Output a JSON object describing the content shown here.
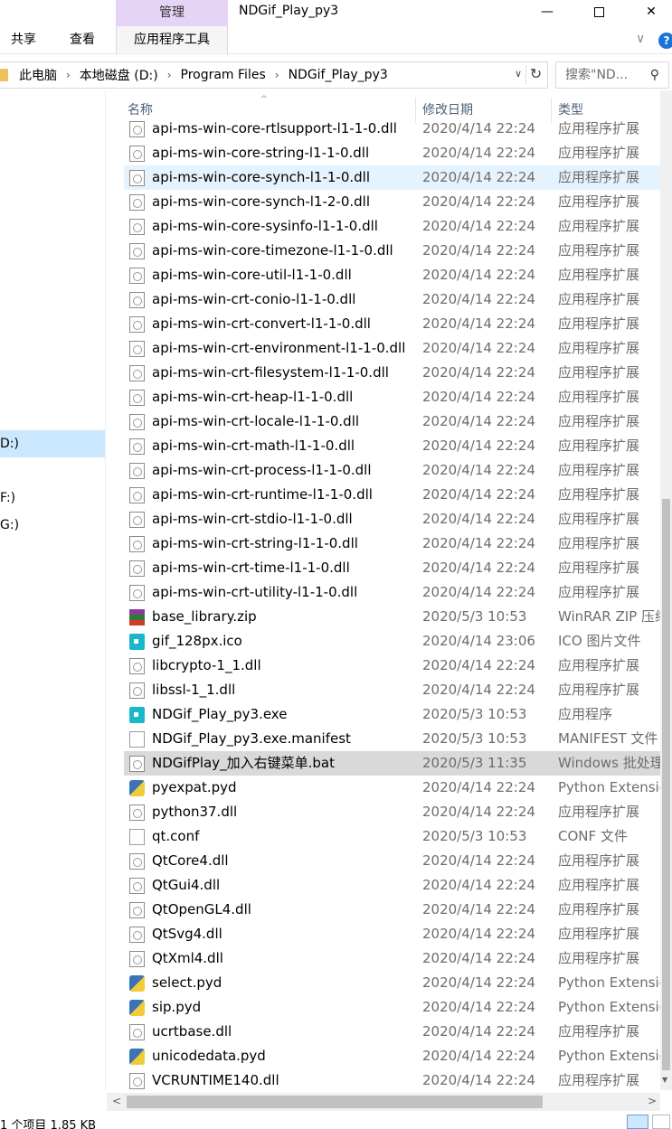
{
  "window": {
    "title": "NDGif_Play_py3",
    "context_tab_group": "管理",
    "min_glyph": "—",
    "close_glyph": "✕"
  },
  "ribbon": {
    "tabs": [
      "共享",
      "查看",
      "应用程序工具"
    ],
    "collapse_glyph": "∨",
    "help_glyph": "?"
  },
  "address": {
    "crumbs": [
      "此电脑",
      "本地磁盘 (D:)",
      "Program Files",
      "NDGif_Play_py3"
    ],
    "separator": "›",
    "dropdown_glyph": "∨",
    "refresh_glyph": "↻"
  },
  "search": {
    "placeholder": "搜索\"ND...",
    "icon_glyph": "⚲"
  },
  "nav": {
    "items": [
      "D:)",
      "F:)",
      "G:)"
    ]
  },
  "columns": {
    "name": "名称",
    "date": "修改日期",
    "type": "类型",
    "sort_glyph": "^"
  },
  "files": [
    {
      "name": "api-ms-win-core-rtlsupport-l1-1-0.dll",
      "date": "2020/4/14 22:24",
      "type": "应用程序扩展",
      "icon": "dll"
    },
    {
      "name": "api-ms-win-core-string-l1-1-0.dll",
      "date": "2020/4/14 22:24",
      "type": "应用程序扩展",
      "icon": "dll"
    },
    {
      "name": "api-ms-win-core-synch-l1-1-0.dll",
      "date": "2020/4/14 22:24",
      "type": "应用程序扩展",
      "icon": "dll",
      "state": "hover"
    },
    {
      "name": "api-ms-win-core-synch-l1-2-0.dll",
      "date": "2020/4/14 22:24",
      "type": "应用程序扩展",
      "icon": "dll"
    },
    {
      "name": "api-ms-win-core-sysinfo-l1-1-0.dll",
      "date": "2020/4/14 22:24",
      "type": "应用程序扩展",
      "icon": "dll"
    },
    {
      "name": "api-ms-win-core-timezone-l1-1-0.dll",
      "date": "2020/4/14 22:24",
      "type": "应用程序扩展",
      "icon": "dll"
    },
    {
      "name": "api-ms-win-core-util-l1-1-0.dll",
      "date": "2020/4/14 22:24",
      "type": "应用程序扩展",
      "icon": "dll"
    },
    {
      "name": "api-ms-win-crt-conio-l1-1-0.dll",
      "date": "2020/4/14 22:24",
      "type": "应用程序扩展",
      "icon": "dll"
    },
    {
      "name": "api-ms-win-crt-convert-l1-1-0.dll",
      "date": "2020/4/14 22:24",
      "type": "应用程序扩展",
      "icon": "dll"
    },
    {
      "name": "api-ms-win-crt-environment-l1-1-0.dll",
      "date": "2020/4/14 22:24",
      "type": "应用程序扩展",
      "icon": "dll"
    },
    {
      "name": "api-ms-win-crt-filesystem-l1-1-0.dll",
      "date": "2020/4/14 22:24",
      "type": "应用程序扩展",
      "icon": "dll"
    },
    {
      "name": "api-ms-win-crt-heap-l1-1-0.dll",
      "date": "2020/4/14 22:24",
      "type": "应用程序扩展",
      "icon": "dll"
    },
    {
      "name": "api-ms-win-crt-locale-l1-1-0.dll",
      "date": "2020/4/14 22:24",
      "type": "应用程序扩展",
      "icon": "dll"
    },
    {
      "name": "api-ms-win-crt-math-l1-1-0.dll",
      "date": "2020/4/14 22:24",
      "type": "应用程序扩展",
      "icon": "dll"
    },
    {
      "name": "api-ms-win-crt-process-l1-1-0.dll",
      "date": "2020/4/14 22:24",
      "type": "应用程序扩展",
      "icon": "dll"
    },
    {
      "name": "api-ms-win-crt-runtime-l1-1-0.dll",
      "date": "2020/4/14 22:24",
      "type": "应用程序扩展",
      "icon": "dll"
    },
    {
      "name": "api-ms-win-crt-stdio-l1-1-0.dll",
      "date": "2020/4/14 22:24",
      "type": "应用程序扩展",
      "icon": "dll"
    },
    {
      "name": "api-ms-win-crt-string-l1-1-0.dll",
      "date": "2020/4/14 22:24",
      "type": "应用程序扩展",
      "icon": "dll"
    },
    {
      "name": "api-ms-win-crt-time-l1-1-0.dll",
      "date": "2020/4/14 22:24",
      "type": "应用程序扩展",
      "icon": "dll"
    },
    {
      "name": "api-ms-win-crt-utility-l1-1-0.dll",
      "date": "2020/4/14 22:24",
      "type": "应用程序扩展",
      "icon": "dll"
    },
    {
      "name": "base_library.zip",
      "date": "2020/5/3 10:53",
      "type": "WinRAR ZIP 压缩",
      "icon": "zip"
    },
    {
      "name": "gif_128px.ico",
      "date": "2020/4/14 23:06",
      "type": "ICO 图片文件",
      "icon": "app"
    },
    {
      "name": "libcrypto-1_1.dll",
      "date": "2020/4/14 22:24",
      "type": "应用程序扩展",
      "icon": "dll"
    },
    {
      "name": "libssl-1_1.dll",
      "date": "2020/4/14 22:24",
      "type": "应用程序扩展",
      "icon": "dll"
    },
    {
      "name": "NDGif_Play_py3.exe",
      "date": "2020/5/3 10:53",
      "type": "应用程序",
      "icon": "app"
    },
    {
      "name": "NDGif_Play_py3.exe.manifest",
      "date": "2020/5/3 10:53",
      "type": "MANIFEST 文件",
      "icon": "doc"
    },
    {
      "name": "NDGifPlay_加入右键菜单.bat",
      "date": "2020/5/3 11:35",
      "type": "Windows 批处理",
      "icon": "dll",
      "state": "selected"
    },
    {
      "name": "pyexpat.pyd",
      "date": "2020/4/14 22:24",
      "type": "Python Extension",
      "icon": "py"
    },
    {
      "name": "python37.dll",
      "date": "2020/4/14 22:24",
      "type": "应用程序扩展",
      "icon": "dll"
    },
    {
      "name": "qt.conf",
      "date": "2020/5/3 10:53",
      "type": "CONF 文件",
      "icon": "doc"
    },
    {
      "name": "QtCore4.dll",
      "date": "2020/4/14 22:24",
      "type": "应用程序扩展",
      "icon": "dll"
    },
    {
      "name": "QtGui4.dll",
      "date": "2020/4/14 22:24",
      "type": "应用程序扩展",
      "icon": "dll"
    },
    {
      "name": "QtOpenGL4.dll",
      "date": "2020/4/14 22:24",
      "type": "应用程序扩展",
      "icon": "dll"
    },
    {
      "name": "QtSvg4.dll",
      "date": "2020/4/14 22:24",
      "type": "应用程序扩展",
      "icon": "dll"
    },
    {
      "name": "QtXml4.dll",
      "date": "2020/4/14 22:24",
      "type": "应用程序扩展",
      "icon": "dll"
    },
    {
      "name": "select.pyd",
      "date": "2020/4/14 22:24",
      "type": "Python Extension",
      "icon": "py"
    },
    {
      "name": "sip.pyd",
      "date": "2020/4/14 22:24",
      "type": "Python Extension",
      "icon": "py"
    },
    {
      "name": "ucrtbase.dll",
      "date": "2020/4/14 22:24",
      "type": "应用程序扩展",
      "icon": "dll"
    },
    {
      "name": "unicodedata.pyd",
      "date": "2020/4/14 22:24",
      "type": "Python Extension",
      "icon": "py"
    },
    {
      "name": "VCRUNTIME140.dll",
      "date": "2020/4/14 22:24",
      "type": "应用程序扩展",
      "icon": "dll"
    }
  ],
  "scroll": {
    "left_glyph": "<",
    "right_glyph": ">",
    "down_glyph": "▼"
  },
  "status": {
    "text": "1 个项目  1.85 KB"
  },
  "colors": {
    "context_tab": "#e5d4f5",
    "hover_row": "#e5f3ff",
    "selected_row": "#d9d9d9",
    "nav_selected": "#cce8ff"
  }
}
